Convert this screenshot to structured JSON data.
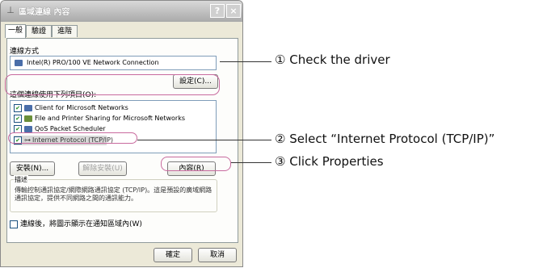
{
  "dialog": {
    "title": "區域連線 內容",
    "help_button": "?",
    "close_button": "×",
    "tabs": [
      "一般",
      "驗證",
      "進階"
    ],
    "connect_using_label": "連線方式",
    "adapter_name": "Intel(R) PRO/100 VE Network Connection",
    "configure_button": "設定(C)...",
    "components_label": "這個連線使用下列項目(O):",
    "components": [
      {
        "label": "Client for Microsoft Networks",
        "checked": true
      },
      {
        "label": "File and Printer Sharing for Microsoft Networks",
        "checked": true
      },
      {
        "label": "QoS Packet Scheduler",
        "checked": true
      },
      {
        "label": "Internet Protocol (TCP/IP)",
        "checked": true
      }
    ],
    "install_button": "安裝(N)...",
    "uninstall_button": "解除安裝(U)",
    "properties_button": "內容(R)",
    "description_legend": "描述",
    "description_text": "傳輸控制通訊協定/網際網路通訊協定 (TCP/IP)。這是預設的廣域網路通訊協定，提供不同網路之間的通訊能力。",
    "show_icon_label": "連線後，將圖示顯示在通知區域內(W)",
    "ok_button": "確定",
    "cancel_button": "取消"
  },
  "annotations": [
    {
      "number": "①",
      "text": "Check the driver"
    },
    {
      "number": "②",
      "text": "Select “Internet Protocol (TCP/IP)”"
    },
    {
      "number": "③",
      "text": "Click Properties"
    }
  ],
  "colors": {
    "highlight": "#c86a9e",
    "dialog_bg": "#ece9d8"
  }
}
